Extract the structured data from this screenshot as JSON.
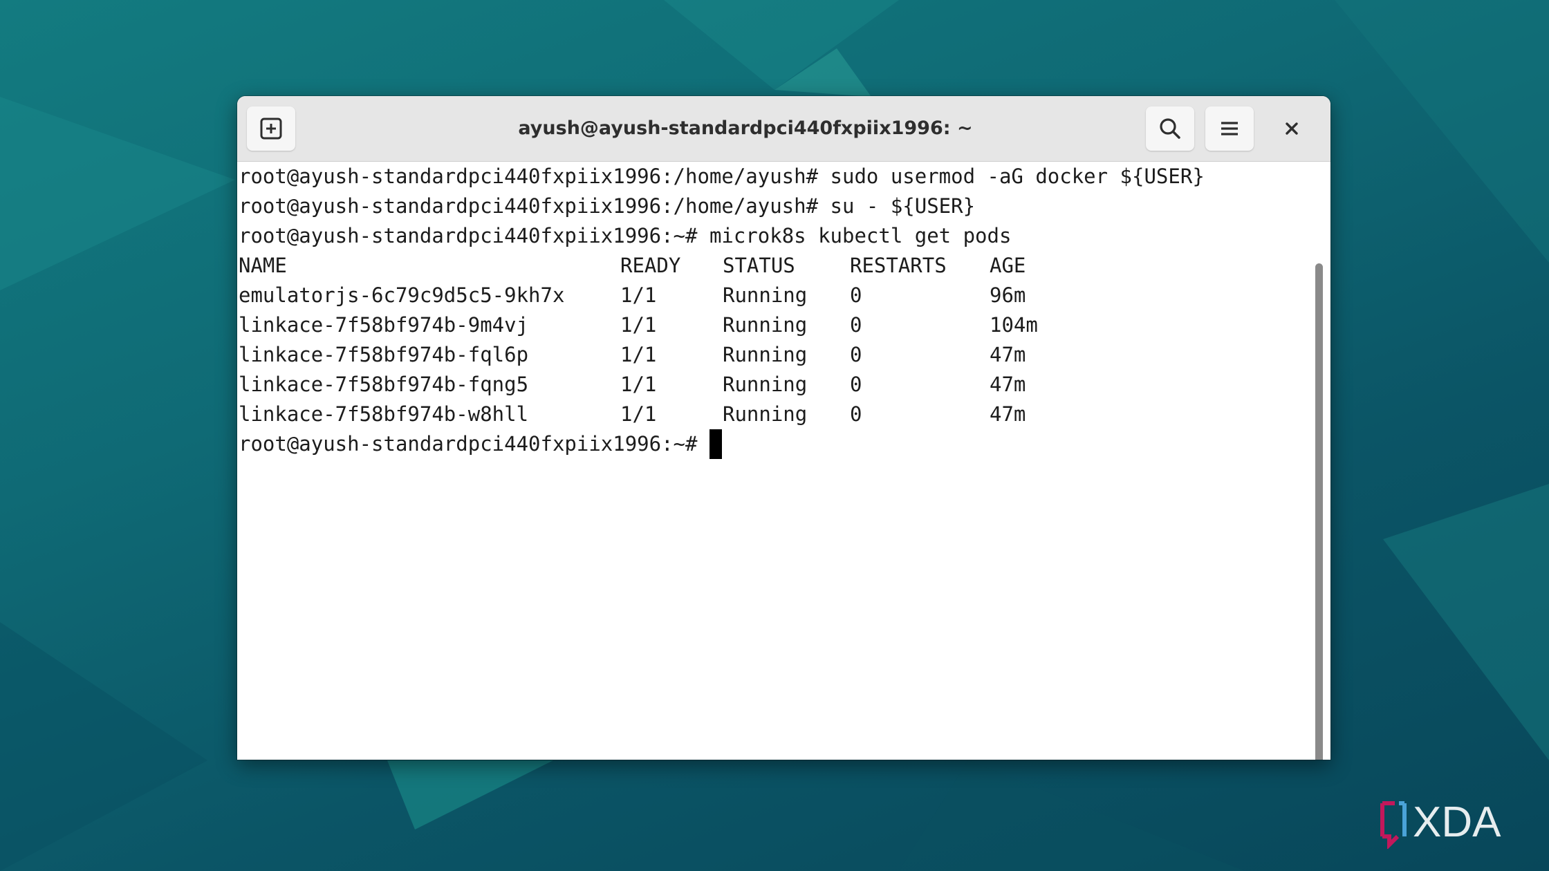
{
  "window": {
    "title": "ayush@ayush-standardpci440fxpiix1996: ~"
  },
  "toolbar": {
    "new_tab_icon": "plus-square-icon",
    "search_icon": "search-icon",
    "menu_icon": "hamburger-menu-icon",
    "close_icon": "close-icon"
  },
  "terminal": {
    "prompt_home": "root@ayush-standardpci440fxpiix1996:/home/ayush#",
    "prompt_tilde": "root@ayush-standardpci440fxpiix1996:~#",
    "commands": [
      "sudo usermod -aG docker ${USER}",
      "su - ${USER}",
      "microk8s kubectl get pods"
    ],
    "table": {
      "headers": [
        "NAME",
        "READY",
        "STATUS",
        "RESTARTS",
        "AGE"
      ],
      "rows": [
        [
          "emulatorjs-6c79c9d5c5-9kh7x",
          "1/1",
          "Running",
          "0",
          "96m"
        ],
        [
          "linkace-7f58bf974b-9m4vj",
          "1/1",
          "Running",
          "0",
          "104m"
        ],
        [
          "linkace-7f58bf974b-fql6p",
          "1/1",
          "Running",
          "0",
          "47m"
        ],
        [
          "linkace-7f58bf974b-fqng5",
          "1/1",
          "Running",
          "0",
          "47m"
        ],
        [
          "linkace-7f58bf974b-w8hll",
          "1/1",
          "Running",
          "0",
          "47m"
        ]
      ]
    }
  },
  "watermark": {
    "text": "XDA"
  },
  "colors": {
    "desktop_bg": "#0d5b6a",
    "titlebar_bg": "#e6e6e6",
    "terminal_bg": "#ffffff",
    "terminal_fg": "#1c1c1c",
    "xda_accent": "#c2185b"
  }
}
